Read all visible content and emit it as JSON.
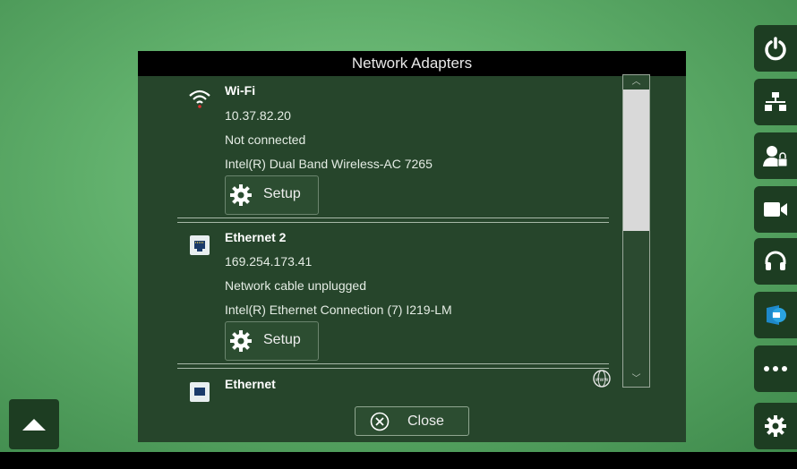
{
  "dialog": {
    "title": "Network Adapters",
    "close_label": "Close",
    "adapters": [
      {
        "name": "Wi-Fi",
        "ip": "10.37.82.20",
        "status": "Not connected",
        "device": "Intel(R) Dual Band Wireless-AC 7265",
        "setup_label": "Setup",
        "icon": "wifi-icon"
      },
      {
        "name": "Ethernet 2",
        "ip": "169.254.173.41",
        "status": "Network cable unplugged",
        "device": "Intel(R) Ethernet Connection (7) I219-LM",
        "setup_label": "Setup",
        "icon": "ethernet-port-icon"
      },
      {
        "name": "Ethernet",
        "icon": "ethernet-port-icon"
      }
    ],
    "scroll_up_glyph": "︿",
    "scroll_down_glyph": "﹀",
    "partial_icon": "www-globe-icon",
    "partial_icon_text": "www"
  },
  "toolbar": {
    "buttons": [
      "power-icon",
      "network-icon",
      "user-lock-icon",
      "camera-icon",
      "headset-icon",
      "meeting-app-icon",
      "more-icon",
      "settings-icon"
    ]
  },
  "colors": {
    "background_green": "#5fae6a",
    "dialog_bg": "#26452b",
    "toolbar_bg": "#1d3d22"
  }
}
